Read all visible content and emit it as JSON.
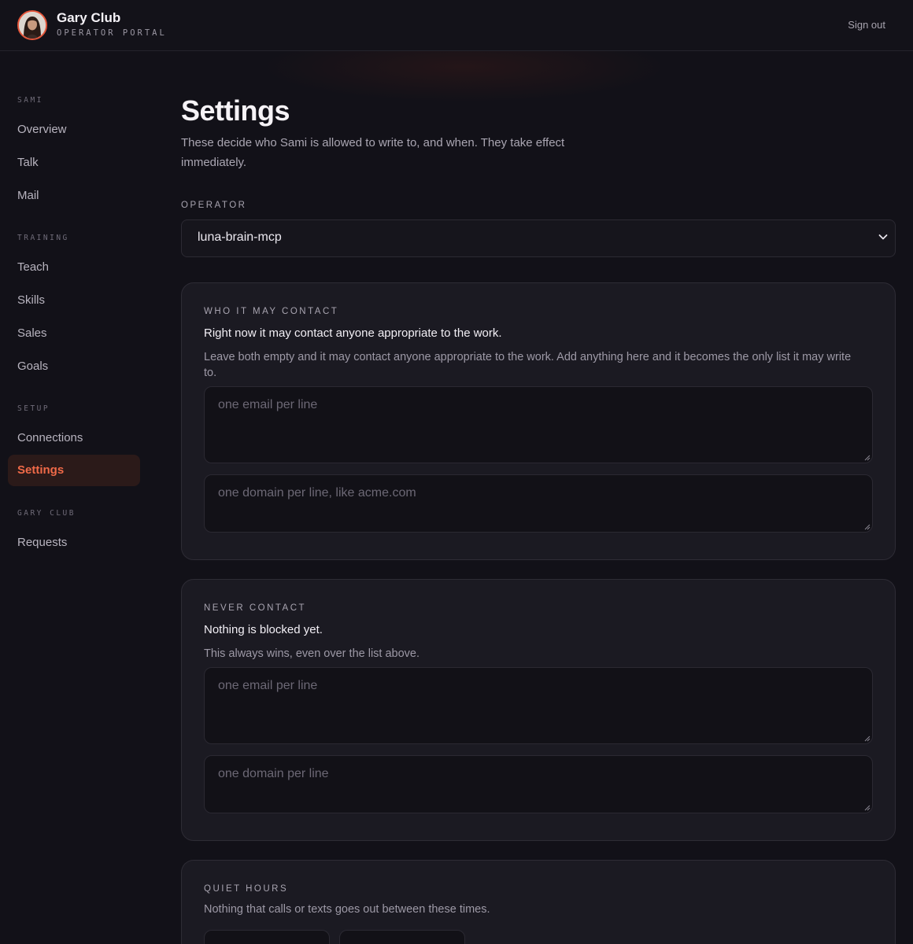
{
  "header": {
    "brand_name": "Gary Club",
    "brand_subtitle": "OPERATOR PORTAL",
    "sign_out": "Sign out"
  },
  "sidebar": {
    "groups": [
      {
        "label": "SAMI",
        "items": [
          "Overview",
          "Talk",
          "Mail"
        ]
      },
      {
        "label": "TRAINING",
        "items": [
          "Teach",
          "Skills",
          "Sales",
          "Goals"
        ]
      },
      {
        "label": "SETUP",
        "items": [
          "Connections",
          "Settings"
        ]
      },
      {
        "label": "GARY CLUB",
        "items": [
          "Requests"
        ]
      }
    ],
    "active_item": "Settings"
  },
  "main": {
    "title": "Settings",
    "description": "These decide who Sami is allowed to write to, and when. They take effect immediately.",
    "operator": {
      "label": "OPERATOR",
      "selected": "luna-brain-mcp"
    },
    "who_may_contact": {
      "label": "WHO IT MAY CONTACT",
      "status": "Right now it may contact anyone appropriate to the work.",
      "help": "Leave both empty and it may contact anyone appropriate to the work. Add anything here and it becomes the only list it may write to.",
      "emails_placeholder": "one email per line",
      "domains_placeholder": "one domain per line, like acme.com"
    },
    "never_contact": {
      "label": "NEVER CONTACT",
      "status": "Nothing is blocked yet.",
      "help": "This always wins, even over the list above.",
      "emails_placeholder": "one email per line",
      "domains_placeholder": "one domain per line"
    },
    "quiet_hours": {
      "label": "QUIET HOURS",
      "help": "Nothing that calls or texts goes out between these times."
    }
  },
  "colors": {
    "accent": "#f06a48",
    "background": "#121118",
    "card": "#1b1a22"
  }
}
